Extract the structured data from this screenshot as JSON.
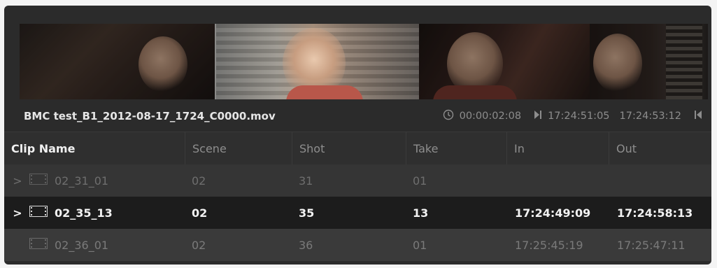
{
  "clip": {
    "filename": "BMC test_B1_2012-08-17_1724_C0000.mov",
    "duration": "00:00:02:08",
    "timecode_in": "17:24:51:05",
    "timecode_out": "17:24:53:12"
  },
  "table": {
    "headers": [
      "Clip Name",
      "Scene",
      "Shot",
      "Take",
      "In",
      "Out"
    ],
    "rows": [
      {
        "name": "02_31_01",
        "scene": "02",
        "shot": "31",
        "take": "01",
        "in": "",
        "out": "",
        "expand": ">"
      },
      {
        "name": "02_35_13",
        "scene": "02",
        "shot": "35",
        "take": "13",
        "in": "17:24:49:09",
        "out": "17:24:58:13",
        "expand": ">"
      },
      {
        "name": "02_36_01",
        "scene": "02",
        "shot": "36",
        "take": "01",
        "in": "17:25:45:19",
        "out": "17:25:47:11",
        "expand": ""
      }
    ]
  },
  "icons": {
    "duration": "clock-icon",
    "mark_in": "mark-in-icon",
    "mark_out": "mark-out-icon",
    "clip": "film-clip-icon",
    "expand": "chevron-right-icon"
  },
  "colors": {
    "panel_bg": "#2b2b2b",
    "selected_row_bg": "#1c1c1c",
    "header_text": "#8e8e8e"
  }
}
